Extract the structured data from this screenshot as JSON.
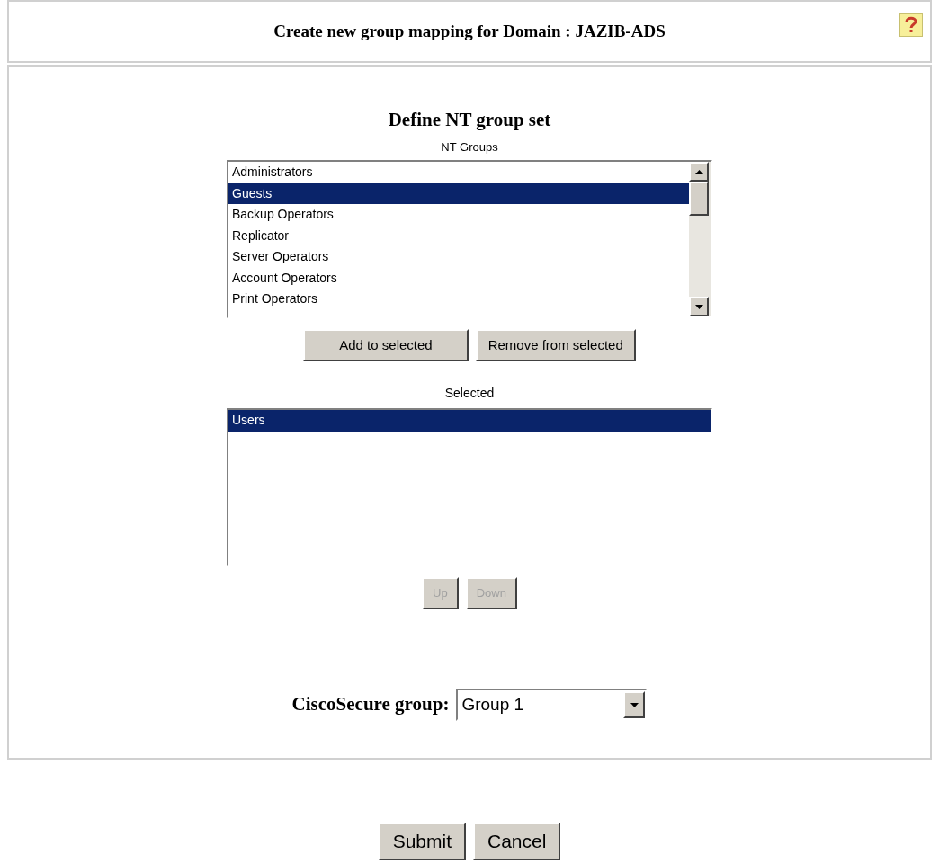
{
  "header": {
    "title": "Create new group mapping for Domain : JAZIB-ADS"
  },
  "section_title": "Define NT group set",
  "nt_groups": {
    "label": "NT Groups",
    "items": [
      {
        "label": "Administrators",
        "selected": false
      },
      {
        "label": "Guests",
        "selected": true
      },
      {
        "label": "Backup Operators",
        "selected": false
      },
      {
        "label": "Replicator",
        "selected": false
      },
      {
        "label": "Server Operators",
        "selected": false
      },
      {
        "label": "Account Operators",
        "selected": false
      },
      {
        "label": "Print Operators",
        "selected": false
      }
    ]
  },
  "transfer_buttons": [
    {
      "label": "Add to selected",
      "disabled": false
    },
    {
      "label": "Remove from selected",
      "disabled": false
    }
  ],
  "selected_groups": {
    "label": "Selected",
    "items": [
      {
        "label": "Users",
        "selected": true
      }
    ]
  },
  "order_buttons": [
    {
      "label": "Up",
      "disabled": true
    },
    {
      "label": "Down",
      "disabled": true
    }
  ],
  "ciscosecure_group": {
    "label": "CiscoSecure group:",
    "value": "Group 1"
  },
  "form_buttons": [
    "Submit",
    "Cancel"
  ]
}
